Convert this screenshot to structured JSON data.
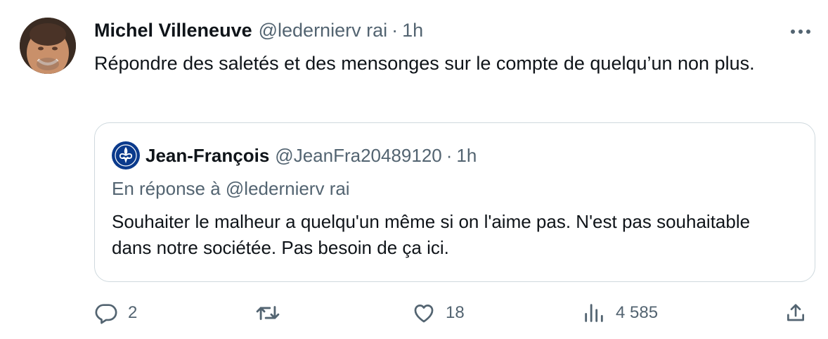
{
  "tweet": {
    "author_name": "Michel Villeneuve",
    "author_handle": "@ledernierv rai",
    "separator": "·",
    "time": "1h",
    "text": "Répondre des saletés et des mensonges sur le compte de quelqu’un non plus."
  },
  "quote": {
    "author_name": "Jean-François",
    "author_handle": "@JeanFra20489120",
    "separator": "·",
    "time": "1h",
    "reply_prefix": "En réponse à",
    "reply_handle": "@ledernierv rai",
    "text": "Souhaiter le malheur a quelqu'un même si on l'aime pas. N'est pas souhaitable dans notre sociétée. Pas besoin de ça ici."
  },
  "actions": {
    "reply_count": "2",
    "retweet_count": "",
    "like_count": "18",
    "view_count": "4 585"
  },
  "icons": {
    "more": "more-horizontal-icon",
    "reply": "reply-icon",
    "retweet": "retweet-icon",
    "like": "heart-icon",
    "views": "views-icon",
    "share": "share-icon"
  },
  "colors": {
    "text": "#0f1419",
    "secondary": "#536471",
    "border": "#cfd9de",
    "quote_avatar": "#0a3a8c"
  }
}
